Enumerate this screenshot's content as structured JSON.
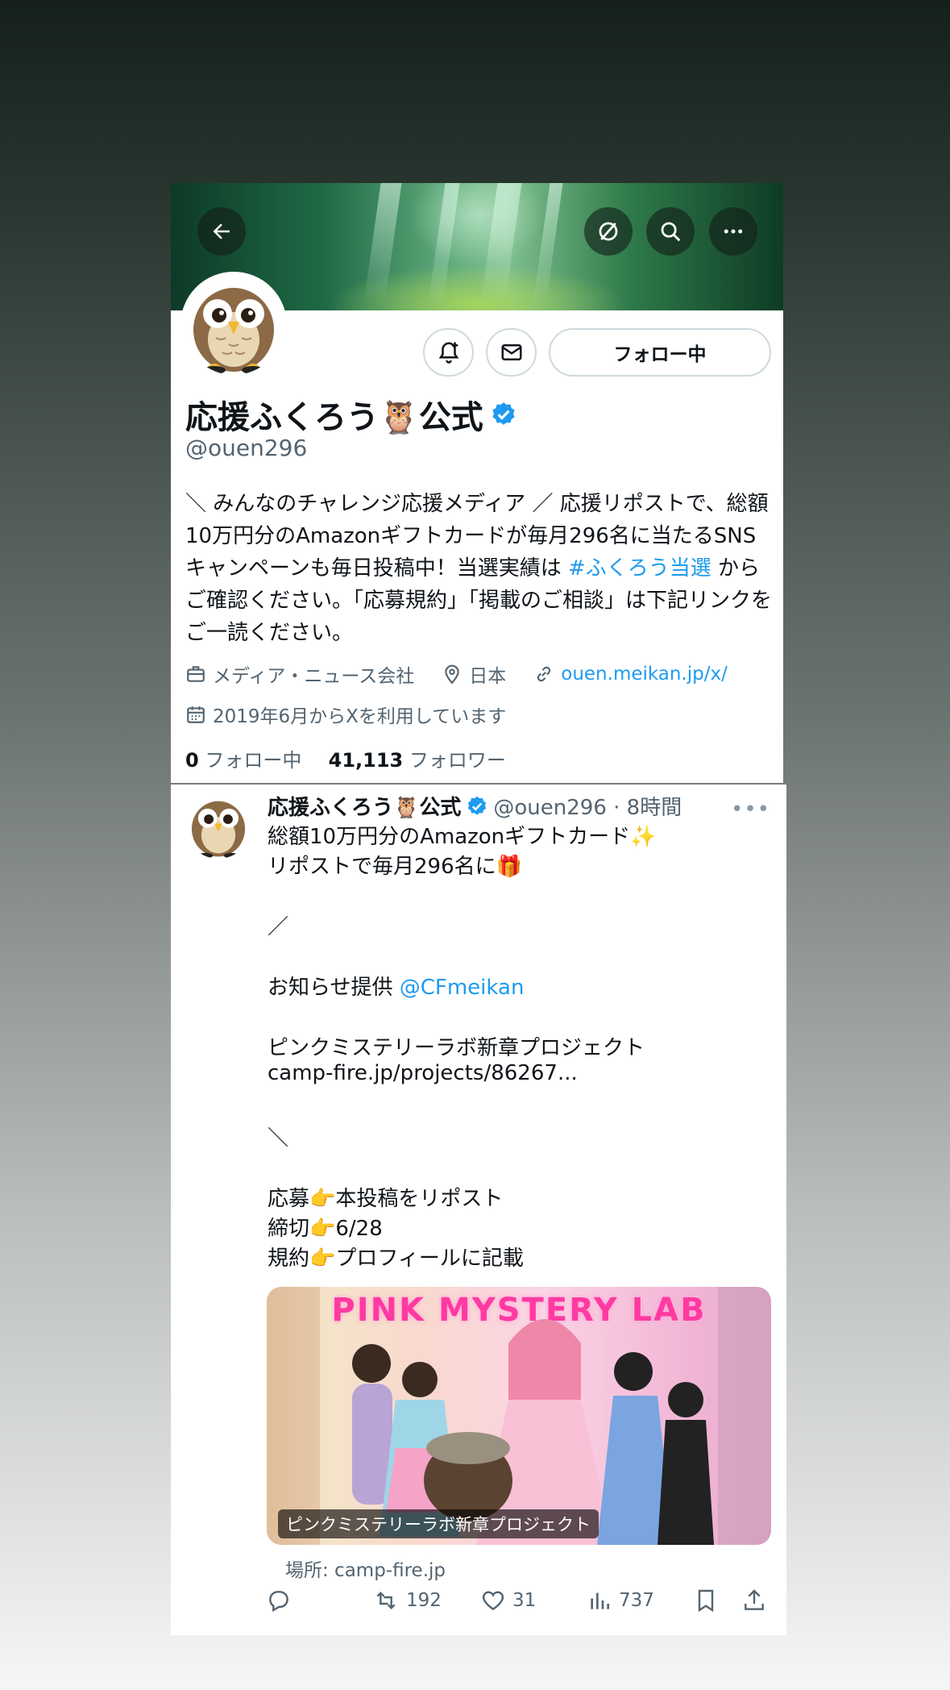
{
  "profile": {
    "name": "応援ふくろう🦉公式",
    "handle": "@ouen296",
    "follow_button": "フォロー中",
    "bio_segments": [
      {
        "text": "＼ みんなのチャレンジ応援メディア ／ 応援リポストで、総額10万円分のAmazonギフトカードが毎月296名に当たるSNSキャンペーンも毎日投稿中！当選実績は ",
        "link": false
      },
      {
        "text": "#ふくろう当選",
        "link": true
      },
      {
        "text": " からご確認ください。「応募規約」「掲載のご相談」は下記リンクをご一読ください。",
        "link": false
      }
    ],
    "category": "メディア・ニュース会社",
    "location": "日本",
    "website": "ouen.meikan.jp/x/",
    "joined": "2019年6月からXを利用しています",
    "following_count": "0",
    "following_label": "フォロー中",
    "followers_count": "41,113",
    "followers_label": "フォロワー"
  },
  "tweet": {
    "name": "応援ふくろう🦉公式",
    "handle_time": "@ouen296 · 8時間",
    "lines": [
      "総額10万円分のAmazonギフトカード✨",
      "リポストで毎月296名に🎁",
      "",
      "／",
      "",
      "お知らせ提供 ",
      "",
      "ピンクミステリーラボ新章プロジェクト",
      "camp-fire.jp/projects/86267...",
      "",
      "＼",
      "",
      "応募👉本投稿をリポスト",
      "締切👉6/28",
      "規約👉プロフィールに記載"
    ],
    "mention": "@CFmeikan",
    "media_title": "PINK MYSTERY LAB",
    "media_caption": "ピンクミステリーラボ新章プロジェクト",
    "source": "場所: camp-fire.jp",
    "retweets": "192",
    "likes": "31",
    "views": "737"
  },
  "colors": {
    "link": "#1d9bf0",
    "secondary_text": "#536471",
    "verified": "#1d9bf0"
  },
  "icons": [
    "back-arrow-icon",
    "grok-icon",
    "search-icon",
    "more-icon",
    "notify-bell-icon",
    "message-icon",
    "verified-badge-icon",
    "briefcase-icon",
    "location-pin-icon",
    "link-icon",
    "calendar-icon",
    "reply-icon",
    "retweet-icon",
    "like-icon",
    "views-icon",
    "bookmark-icon",
    "share-icon"
  ]
}
